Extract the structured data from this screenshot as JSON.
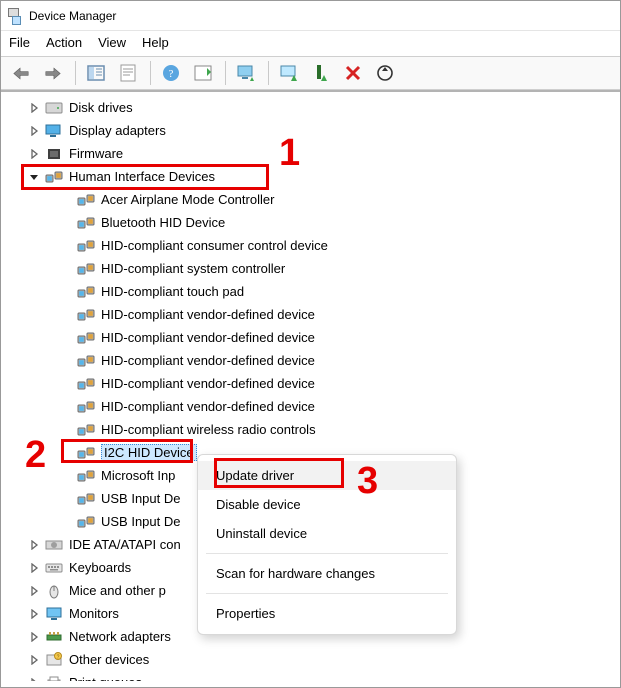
{
  "window": {
    "title": "Device Manager"
  },
  "menubar": {
    "file": "File",
    "action": "Action",
    "view": "View",
    "help": "Help"
  },
  "toolbar": {
    "back": "Back",
    "forward": "Forward",
    "show_hide_tree": "Show/Hide Console Tree",
    "properties": "Properties",
    "help": "Help",
    "action_center": "Show Action Center",
    "update_driver": "Update Device Driver",
    "enable": "Enable Device",
    "uninstall": "Uninstall Device",
    "scan": "Scan for hardware changes"
  },
  "tree": {
    "categories": [
      {
        "label": "Disk drives",
        "expanded": false,
        "icon": "disk"
      },
      {
        "label": "Display adapters",
        "expanded": false,
        "icon": "display"
      },
      {
        "label": "Firmware",
        "expanded": false,
        "icon": "firmware"
      },
      {
        "label": "Human Interface Devices",
        "expanded": true,
        "icon": "hid",
        "children": [
          "Acer Airplane Mode Controller",
          "Bluetooth HID Device",
          "HID-compliant consumer control device",
          "HID-compliant system controller",
          "HID-compliant touch pad",
          "HID-compliant vendor-defined device",
          "HID-compliant vendor-defined device",
          "HID-compliant vendor-defined device",
          "HID-compliant vendor-defined device",
          "HID-compliant vendor-defined device",
          "HID-compliant wireless radio controls",
          "I2C HID Device",
          "Microsoft Inp",
          "USB Input De",
          "USB Input De"
        ],
        "selected_index": 11
      },
      {
        "label": "IDE ATA/ATAPI con",
        "expanded": false,
        "icon": "ide"
      },
      {
        "label": "Keyboards",
        "expanded": false,
        "icon": "keyboard"
      },
      {
        "label": "Mice and other p",
        "expanded": false,
        "icon": "mouse"
      },
      {
        "label": "Monitors",
        "expanded": false,
        "icon": "monitor"
      },
      {
        "label": "Network adapters",
        "expanded": false,
        "icon": "net"
      },
      {
        "label": "Other devices",
        "expanded": false,
        "icon": "other"
      },
      {
        "label": "Print queues",
        "expanded": false,
        "icon": "print"
      }
    ]
  },
  "context_menu": {
    "update": "Update driver",
    "disable": "Disable device",
    "uninstall": "Uninstall device",
    "scan": "Scan for hardware changes",
    "properties": "Properties"
  },
  "annotations": {
    "n1": "1",
    "n2": "2",
    "n3": "3"
  }
}
